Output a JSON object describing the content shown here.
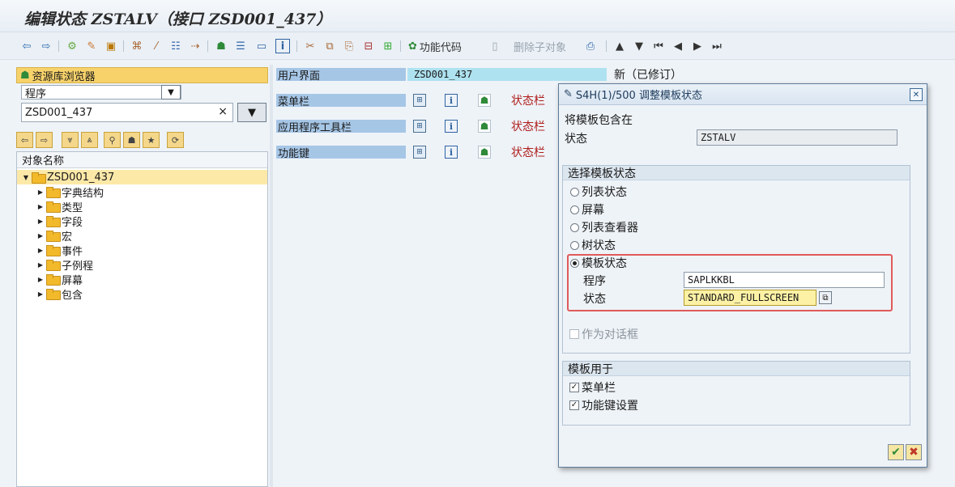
{
  "window": {
    "title": "编辑状态 ZSTALV（接口 ZSD001_437）"
  },
  "toolbar": {
    "function_code_label": "功能代码",
    "delete_child_label": "删除子对象",
    "icons": [
      "back-arrow",
      "forward-arrow",
      "other-object",
      "display-change",
      "activate",
      "where-used",
      "hierarchy",
      "test",
      "object-list",
      "navigate",
      "text-align",
      "window",
      "info",
      "cut",
      "copy",
      "paste",
      "delete-row",
      "insert-row",
      "function-code",
      "document",
      "print",
      "move-up",
      "move-down",
      "first",
      "previous",
      "next",
      "last"
    ]
  },
  "repo": {
    "header": "资源库浏览器",
    "object_type": "程序",
    "object_name": "ZSD001_437",
    "clear_glyph": "×",
    "tree_header": "对象名称",
    "root": "ZSD001_437",
    "nodes": [
      "字典结构",
      "类型",
      "字段",
      "宏",
      "事件",
      "子例程",
      "屏幕",
      "包含"
    ]
  },
  "main": {
    "user_interface_label": "用户界面",
    "user_interface_value": "ZSD001_437",
    "status": "新（已修订）",
    "rows": [
      {
        "label": "菜单栏",
        "status": "状态栏"
      },
      {
        "label": "应用程序工具栏",
        "status": "状态栏"
      },
      {
        "label": "功能键",
        "status": "状态栏"
      }
    ]
  },
  "dialog": {
    "title": "S4H(1)/500 调整模板状态",
    "include_in_label": "将模板包含在",
    "status_label": "状态",
    "status_value": "ZSTALV",
    "select_group": "选择模板状态",
    "options": [
      "列表状态",
      "屏幕",
      "列表查看器",
      "树状态",
      "模板状态"
    ],
    "selected_option": "模板状态",
    "program_label": "程序",
    "program_value": "SAPLKKBL",
    "template_status_label": "状态",
    "template_status_value": "STANDARD_FULLSCREEN",
    "as_dialog_label": "作为对话框",
    "use_group": "模板用于",
    "use_menubar": "菜单栏",
    "use_fkeys": "功能键设置",
    "confirm": "✔",
    "cancel": "✖"
  },
  "colors": {
    "label_blue": "#a6c6e6",
    "value_cyan": "#aee2f0",
    "status_red": "#b0201e",
    "highlight": "#f7d26b"
  }
}
